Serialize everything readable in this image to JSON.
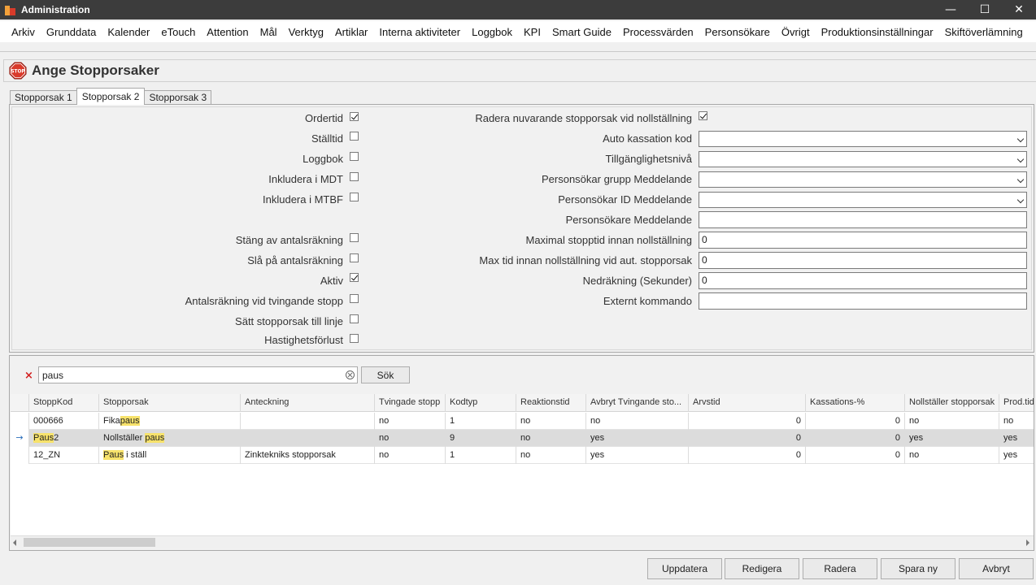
{
  "window": {
    "title": "Administration",
    "controls": [
      "—",
      "☐",
      "✕"
    ]
  },
  "menu": [
    "Arkiv",
    "Grunddata",
    "Kalender",
    "eTouch",
    "Attention",
    "Mål",
    "Verktyg",
    "Artiklar",
    "Interna aktiviteter",
    "Loggbok",
    "KPI",
    "Smart Guide",
    "Processvärden",
    "Personsökare",
    "Övrigt",
    "Produktionsinställningar",
    "Skiftöverlämning"
  ],
  "header": {
    "title": "Ange Stopporsaker",
    "icon_text": "STOP"
  },
  "tabs": [
    "Stopporsak 1",
    "Stopporsak 2",
    "Stopporsak 3"
  ],
  "left_fields": {
    "ordertid": {
      "label": "Ordertid",
      "checked": true
    },
    "stalltid": {
      "label": "Ställtid",
      "checked": false
    },
    "loggbok": {
      "label": "Loggbok",
      "checked": false
    },
    "mdt": {
      "label": "Inkludera i MDT",
      "checked": false
    },
    "mtbf": {
      "label": "Inkludera i MTBF",
      "checked": false
    },
    "stang_antal": {
      "label": "Stäng av antalsräkning",
      "checked": false
    },
    "sla_antal": {
      "label": "Slå på antalsräkning",
      "checked": false
    },
    "aktiv": {
      "label": "Aktiv",
      "checked": true
    },
    "antal_tvingande": {
      "label": "Antalsräkning vid tvingande stopp",
      "checked": false
    },
    "satt_linje": {
      "label": "Sätt stopporsak till linje",
      "checked": false
    },
    "hastighet": {
      "label": "Hastighetsförlust",
      "checked": false
    }
  },
  "right_fields": {
    "radera": {
      "label": "Radera nuvarande stopporsak vid nollställning",
      "checked": true
    },
    "auto_kassation": {
      "label": "Auto kassation kod",
      "value": ""
    },
    "tillganglighet": {
      "label": "Tillgänglighetsnivå",
      "value": ""
    },
    "ps_grupp": {
      "label": "Personsökar grupp Meddelande",
      "value": ""
    },
    "ps_id": {
      "label": "Personsökar ID Meddelande",
      "value": ""
    },
    "ps_medd": {
      "label": "Personsökare Meddelande",
      "value": ""
    },
    "max_stopptid": {
      "label": "Maximal stopptid innan nollställning",
      "value": "0"
    },
    "max_tid_aut": {
      "label": "Max tid innan nollställning vid aut. stopporsak",
      "value": "0"
    },
    "nedrakning": {
      "label": "Nedräkning (Sekunder)",
      "value": "0"
    },
    "externt": {
      "label": "Externt kommando",
      "value": ""
    }
  },
  "search": {
    "value": "paus",
    "button": "Sök",
    "clear_symbol": "×"
  },
  "grid": {
    "columns": [
      "StoppKod",
      "Stopporsak",
      "Anteckning",
      "Tvingade stopp",
      "Kodtyp",
      "Reaktionstid",
      "Avbryt Tvingande sto...",
      "Arvstid",
      "Kassations-%",
      "Nollställer stopporsak",
      "Prod.tid"
    ],
    "rows": [
      {
        "kod_pre": "",
        "kod_hl": "",
        "kod_post": "000666",
        "orsak_pre": "Fika",
        "orsak_hl": "paus",
        "orsak_post": "",
        "anteckning": "",
        "tvingade": "no",
        "kodtyp": "1",
        "reaktion": "no",
        "avbryt": "no",
        "arvstid": "0",
        "kassation": "0",
        "nollstaller": "no",
        "prodtid": "no",
        "selected": false
      },
      {
        "kod_pre": "",
        "kod_hl": "Paus",
        "kod_post": "2",
        "orsak_pre": "Nollställer ",
        "orsak_hl": "paus",
        "orsak_post": "",
        "anteckning": "",
        "tvingade": "no",
        "kodtyp": "9",
        "reaktion": "no",
        "avbryt": "yes",
        "arvstid": "0",
        "kassation": "0",
        "nollstaller": "yes",
        "prodtid": "yes",
        "selected": true
      },
      {
        "kod_pre": "",
        "kod_hl": "",
        "kod_post": "12_ZN",
        "orsak_pre": "",
        "orsak_hl": "Paus",
        "orsak_post": " i ställ",
        "anteckning": "Zinktekniks stopporsak",
        "tvingade": "no",
        "kodtyp": "1",
        "reaktion": "no",
        "avbryt": "yes",
        "arvstid": "0",
        "kassation": "0",
        "nollstaller": "no",
        "prodtid": "yes",
        "selected": false
      }
    ],
    "current_row_marker": "→"
  },
  "buttons": {
    "uppdatera": "Uppdatera",
    "redigera": "Redigera",
    "radera": "Radera",
    "spara_ny": "Spara ny",
    "avbryt": "Avbryt"
  },
  "colors": {
    "titlebar": "#3c3c3c",
    "highlight": "#f7e26b",
    "stop_red": "#d93a2b",
    "selected_row": "#dcdcdc"
  }
}
